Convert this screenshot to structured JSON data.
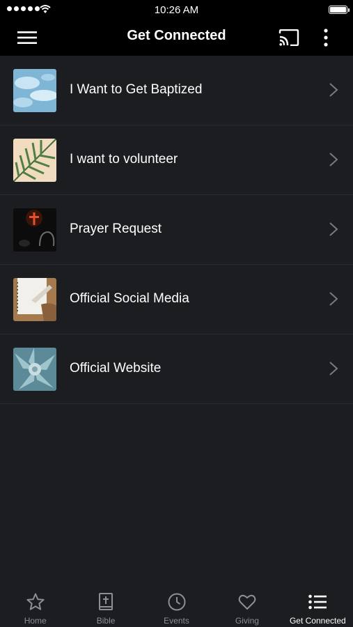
{
  "status_bar": {
    "time": "10:26 AM"
  },
  "app_bar": {
    "title": "Get Connected"
  },
  "items": [
    {
      "label": "I Want to Get Baptized"
    },
    {
      "label": "I want to volunteer"
    },
    {
      "label": "Prayer Request"
    },
    {
      "label": "Official Social Media"
    },
    {
      "label": "Official Website"
    }
  ],
  "tabs": [
    {
      "label": "Home",
      "icon": "star-icon"
    },
    {
      "label": "Bible",
      "icon": "bible-icon"
    },
    {
      "label": "Events",
      "icon": "clock-icon"
    },
    {
      "label": "Giving",
      "icon": "heart-icon"
    },
    {
      "label": "Get Connected",
      "icon": "list-icon",
      "active": true
    }
  ],
  "colors": {
    "bar_background": "#000000",
    "page_background": "#1c1d20",
    "inactive_tab": "#8e8e93"
  }
}
